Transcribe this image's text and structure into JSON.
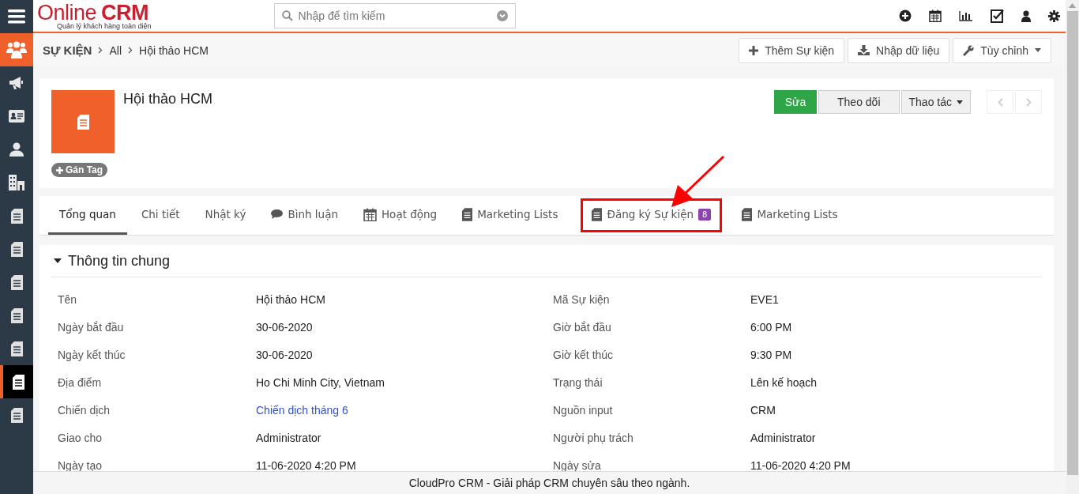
{
  "header": {
    "logo": {
      "brand_part1": "Online",
      "brand_part2": "CRM",
      "tagline": "Quản lý khách hàng toàn diện"
    },
    "search": {
      "placeholder": "Nhập để tìm kiếm"
    }
  },
  "sidebar": {
    "items": [
      {
        "kind": "people",
        "selected": false,
        "module": true
      },
      {
        "kind": "megaphone",
        "selected": false,
        "module": false
      },
      {
        "kind": "card",
        "selected": false,
        "module": false
      },
      {
        "kind": "person",
        "selected": false,
        "module": false
      },
      {
        "kind": "building",
        "selected": false,
        "module": false
      },
      {
        "kind": "document",
        "selected": false,
        "module": false
      },
      {
        "kind": "document",
        "selected": false,
        "module": false
      },
      {
        "kind": "document",
        "selected": false,
        "module": false
      },
      {
        "kind": "document",
        "selected": false,
        "module": false
      },
      {
        "kind": "document",
        "selected": false,
        "module": false
      },
      {
        "kind": "document",
        "selected": true,
        "module": false
      },
      {
        "kind": "document",
        "selected": false,
        "module": false
      }
    ]
  },
  "breadcrumb": [
    "SỰ KIỆN",
    "All",
    "Hội thảo HCM"
  ],
  "toolbar_buttons": [
    {
      "kind": "plus",
      "label": "Thêm Sự kiện",
      "dropdown": false
    },
    {
      "kind": "download",
      "label": "Nhập dữ liệu",
      "dropdown": false
    },
    {
      "kind": "wrench",
      "label": "Tùy chỉnh",
      "dropdown": true
    }
  ],
  "record": {
    "title": "Hội thảo HCM",
    "tag_button": "Gán Tag",
    "actions": [
      {
        "label": "Sửa",
        "kind": "primary",
        "dropdown": false
      },
      {
        "label": "Theo dõi",
        "kind": "default",
        "dropdown": false
      },
      {
        "label": "Thao tác",
        "kind": "default",
        "dropdown": true
      }
    ]
  },
  "tabs": [
    {
      "label": "Tổng quan",
      "kind": "plain",
      "selected": true,
      "highlighted": false
    },
    {
      "label": "Chi tiết",
      "kind": "plain",
      "selected": false,
      "highlighted": false
    },
    {
      "label": "Nhật ký",
      "kind": "plain",
      "selected": false,
      "highlighted": false
    },
    {
      "label": "Bình luận",
      "kind": "comment",
      "selected": false,
      "highlighted": false
    },
    {
      "label": "Hoạt động",
      "kind": "calendar",
      "selected": false,
      "highlighted": false
    },
    {
      "label": "Marketing Lists",
      "kind": "document",
      "selected": false,
      "highlighted": false
    },
    {
      "label": "Đăng ký Sự kiện",
      "kind": "document",
      "selected": false,
      "highlighted": true,
      "badge": "8"
    },
    {
      "label": "Marketing Lists",
      "kind": "document",
      "selected": false,
      "highlighted": false
    }
  ],
  "section": {
    "title": "Thông tin chung",
    "expanded": true,
    "fields": [
      {
        "label": "Tên",
        "value": "Hội thảo HCM",
        "kind": "text"
      },
      {
        "label": "Mã Sự kiện",
        "value": "EVE1",
        "kind": "text"
      },
      {
        "label": "Ngày bắt đầu",
        "value": "30-06-2020",
        "kind": "text"
      },
      {
        "label": "Giờ bắt đầu",
        "value": "6:00 PM",
        "kind": "text"
      },
      {
        "label": "Ngày kết thúc",
        "value": "30-06-2020",
        "kind": "text"
      },
      {
        "label": "Giờ kết thúc",
        "value": "9:30 PM",
        "kind": "text"
      },
      {
        "label": "Địa điểm",
        "value": "Ho Chi Minh City, Vietnam",
        "kind": "text"
      },
      {
        "label": "Trạng thái",
        "value": "Lên kế hoạch",
        "kind": "text"
      },
      {
        "label": "Chiến dịch",
        "value": "Chiến dịch tháng 6",
        "kind": "link"
      },
      {
        "label": "Nguồn input",
        "value": "CRM",
        "kind": "text"
      },
      {
        "label": "Giao cho",
        "value": "Administrator",
        "kind": "text"
      },
      {
        "label": "Người phụ trách",
        "value": "Administrator",
        "kind": "text"
      },
      {
        "label": "Ngày tạo",
        "value": "11-06-2020 4:20 PM",
        "kind": "text"
      },
      {
        "label": "Ngày sửa",
        "value": "11-06-2020 4:20 PM",
        "kind": "text"
      }
    ]
  },
  "footer": "CloudPro CRM - Giải pháp CRM chuyên sâu theo ngành."
}
